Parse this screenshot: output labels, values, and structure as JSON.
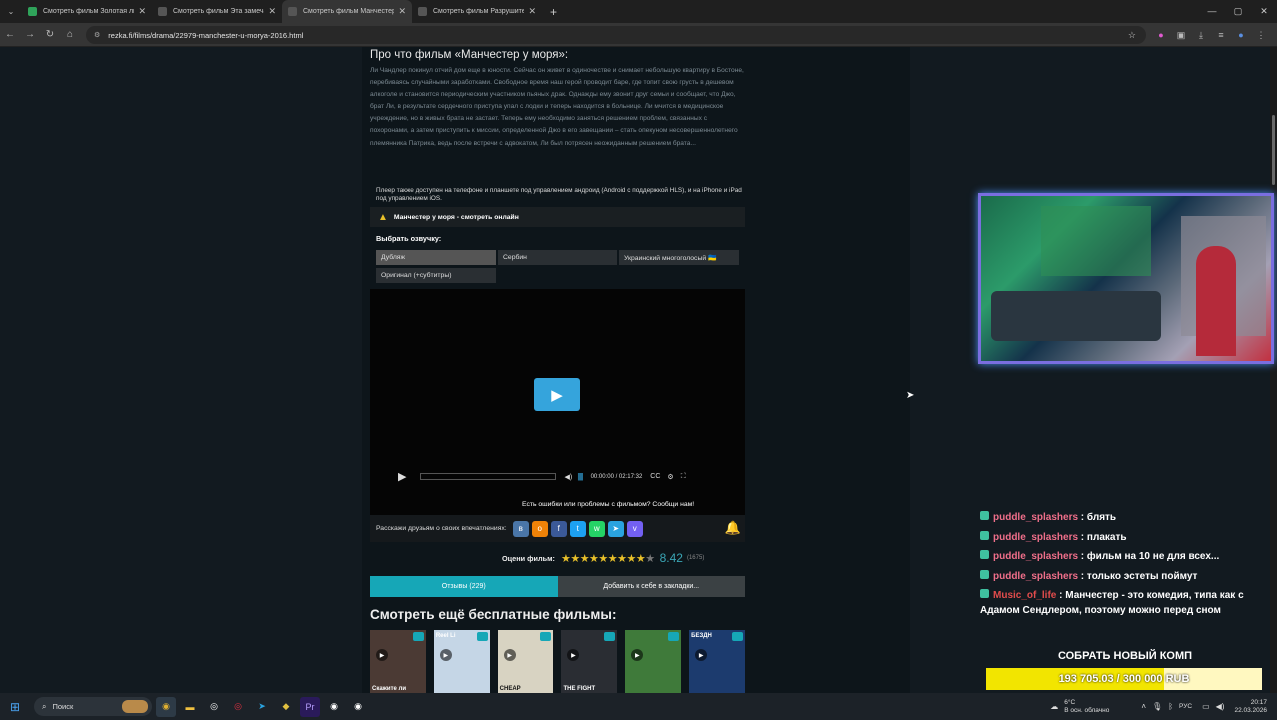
{
  "browser": {
    "tabs": [
      {
        "title": "Смотреть фильм Золотая лих",
        "color": "#2fa35a"
      },
      {
        "title": "Смотреть фильм Эта замечат",
        "color": "#555"
      },
      {
        "title": "Смотреть фильм Манчестер у",
        "color": "#555"
      },
      {
        "title": "Смотреть фильм Разрушител",
        "color": "#555"
      }
    ],
    "url": "rezka.fi/films/drama/22979-manchester-u-morya-2016.html"
  },
  "page": {
    "heading": "Про что фильм «Манчестер у моря»:",
    "description": "Ли Чандлер покинул отчий дом еще в юности. Сейчас он живет в одиночестве и снимает небольшую квартиру в Бостоне, перебиваясь случайными заработками. Свободное время наш герой проводит баре, где топит свою грусть в дешевом алкоголе и становится периодическим участником пьяных драк. Однажды ему звонит друг семьи и сообщает, что Джо, брат Ли, в результате сердечного приступа упал с лодки и теперь находится в больнице. Ли мчится в медицинское учреждение, но в живых брата не застает. Теперь ему необходимо заняться решением проблем, связанных с похоронами, а затем приступить к миссии, определенной Джо в его завещании – стать опекуном несовершеннолетнего племянника Патрика, ведь после встречи с адвокатом, Ли был потрясен неожиданным решением брата...",
    "player_note": "Плеер также доступен на телефоне и планшете под управлением андроид (Android с поддержкой HLS), и на iPhone и iPad под управлением iOS.",
    "watch_title": "Манчестер у моря - смотреть онлайн",
    "dub_label": "Выбрать озвучку:",
    "dubs": [
      "Дубляж",
      "Сербин",
      "Украинский многоголосый 🇺🇦",
      "Оригинал (+субтитры)"
    ],
    "time": "00:00:00 / 02:17:32",
    "error_note": "Есть ошибки или проблемы с фильмом? Сообщи нам!",
    "share_label": "Расскажи друзьям о своих впечатлениях:",
    "rating_label": "Оцени фильм:",
    "rating_value": "8.42",
    "rating_count": "(1675)",
    "tab_reviews": "Отзывы (229)",
    "tab_bookmarks": "Добавить к себе в закладки...",
    "more_heading": "Смотреть ещё бесплатные фильмы:",
    "posters": [
      {
        "caption": "Скажите ли",
        "color": "#4b3a34"
      },
      {
        "caption": "Reel Li",
        "color": "#c5d6e6"
      },
      {
        "caption": "CHEAP",
        "color": "#d8d3c2"
      },
      {
        "caption": "THE FIGHT",
        "color": "#2a2d33"
      },
      {
        "caption": "",
        "color": "#3f7a3a"
      },
      {
        "caption": "БЕЗДН",
        "color": "#1c3b6e"
      }
    ]
  },
  "stream": {
    "chat": [
      {
        "user": "puddle_splashers",
        "text": "блять"
      },
      {
        "user": "puddle_splashers",
        "text": "плакать"
      },
      {
        "user": "puddle_splashers",
        "text": "фильм на 10 не для всех..."
      },
      {
        "user": "puddle_splashers",
        "text": "только эстеты поймут"
      },
      {
        "user": "Music_of_life",
        "text": "Манчестер - это комедия, типа как с Адамом Сендлером, поэтому можно перед сном"
      }
    ],
    "goal_title": "СОБРАТЬ НОВЫЙ КОМП",
    "goal_value": "193 705.03 / 300 000 RUB",
    "goal_fraction": 0.646
  },
  "taskbar": {
    "search": "Поиск",
    "weather_temp": "6°C",
    "weather_desc": "В осн. облачно",
    "lang": "РУС",
    "time": "20:17",
    "date": "22.03.2026"
  }
}
